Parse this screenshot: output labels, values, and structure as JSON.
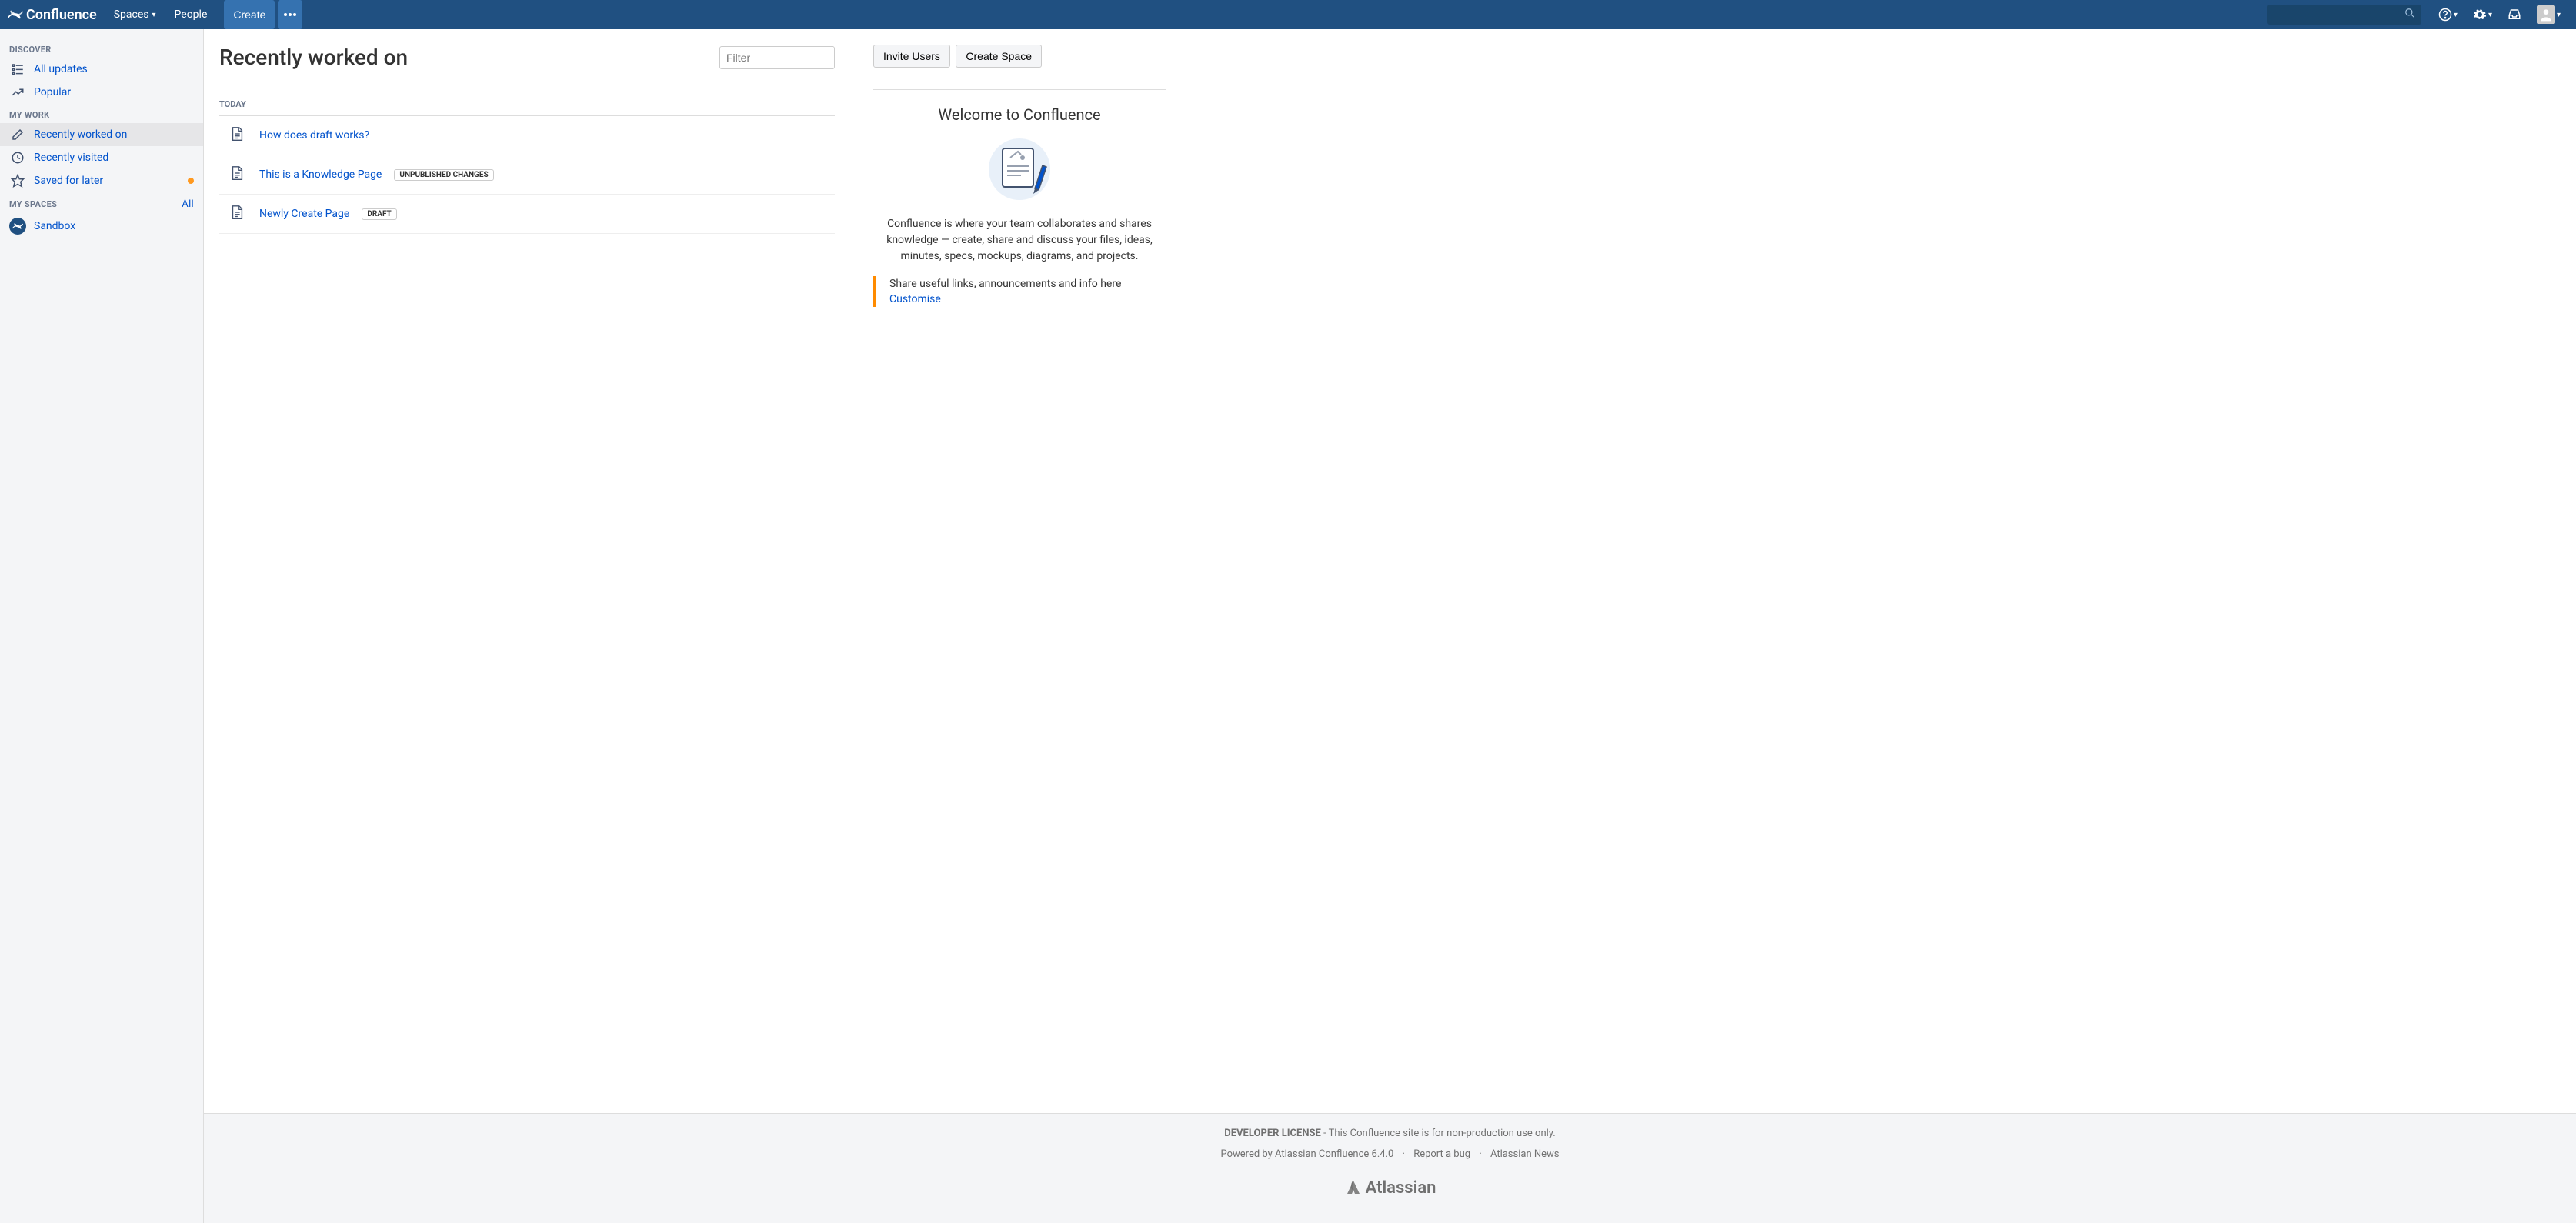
{
  "header": {
    "brand": "Confluence",
    "spaces": "Spaces",
    "people": "People",
    "create": "Create"
  },
  "sidebar": {
    "discover": {
      "heading": "Discover",
      "all_updates": "All updates",
      "popular": "Popular"
    },
    "mywork": {
      "heading": "My Work",
      "recently_worked": "Recently worked on",
      "recently_visited": "Recently visited",
      "saved_for_later": "Saved for later"
    },
    "myspaces": {
      "heading": "My Spaces",
      "all": "All",
      "sandbox": "Sandbox"
    }
  },
  "main": {
    "title": "Recently worked on",
    "filter_placeholder": "Filter",
    "group_date": "Today",
    "items": [
      {
        "title": "How does draft works?",
        "badge": ""
      },
      {
        "title": "This is a Knowledge Page",
        "badge": "Unpublished changes"
      },
      {
        "title": "Newly Create Page",
        "badge": "Draft"
      }
    ]
  },
  "right": {
    "invite": "Invite Users",
    "create_space": "Create Space",
    "welcome_title": "Welcome to Confluence",
    "welcome_text": "Confluence is where your team collaborates and shares knowledge — create, share and discuss your files, ideas, minutes, specs, mockups, diagrams, and projects.",
    "share_text": "Share useful links, announcements and info here",
    "customise": "Customise"
  },
  "footer": {
    "license_label": "DEVELOPER LICENSE",
    "license_rest": " - This Confluence site is for non-production use only.",
    "powered": "Powered by Atlassian Confluence 6.4.0",
    "report": "Report a bug",
    "news": "Atlassian News",
    "atlassian": "Atlassian"
  }
}
